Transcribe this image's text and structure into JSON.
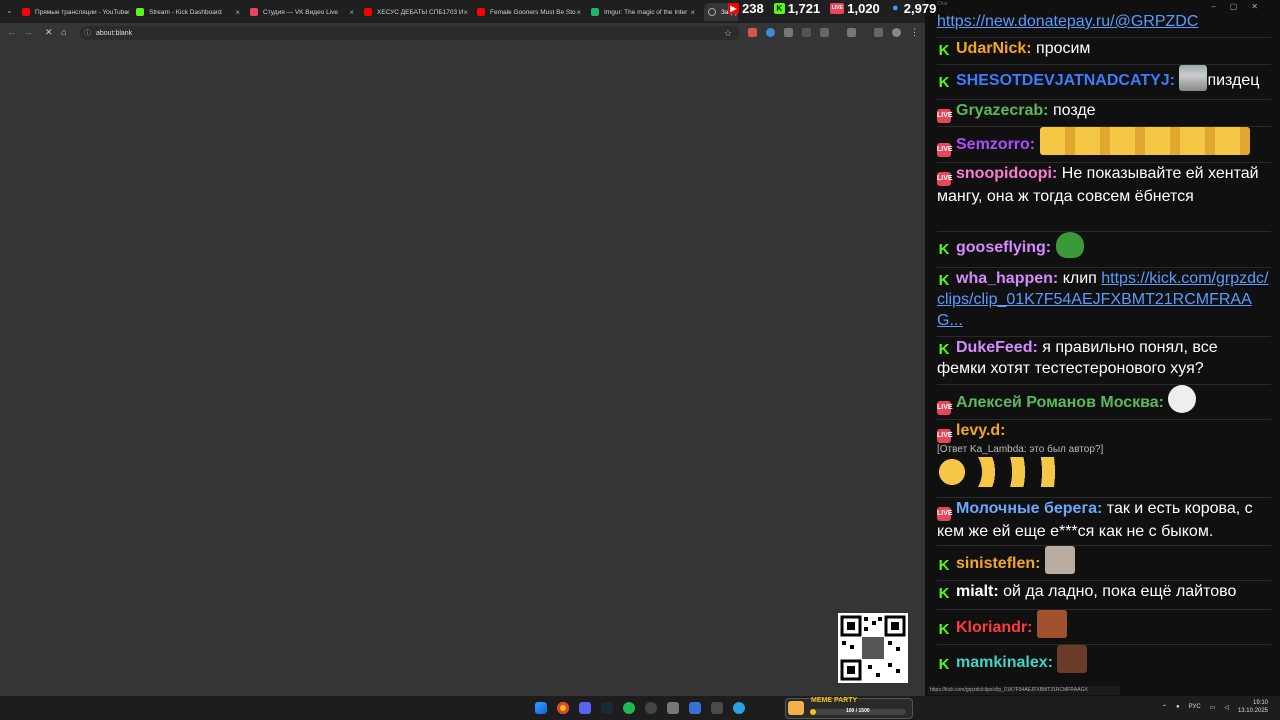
{
  "browser": {
    "tabs": [
      {
        "title": "Прямые трансляции - YouTube",
        "color": "#ff0000"
      },
      {
        "title": "Stream - Kick Dashboard",
        "color": "#53fc18"
      },
      {
        "title": "Студия — VK Видео Live",
        "color": "#e8465a"
      },
      {
        "title": "ХЕСУС ДЕБАТЫ СПБ1703 И",
        "color": "#ff0000"
      },
      {
        "title": "Female Gooners Must Be Sto",
        "color": "#ff0000"
      },
      {
        "title": "Imgur: The magic of the Inter",
        "color": "#1bb76e"
      },
      {
        "title": "Загру",
        "color": "#888888"
      }
    ],
    "address": "about:blank"
  },
  "stats": [
    {
      "platform": "youtube",
      "count": "238",
      "color": "#ff0000",
      "glyph": "▶"
    },
    {
      "platform": "kick",
      "count": "1,721",
      "color": "#53fc18",
      "glyph": "K"
    },
    {
      "platform": "vk",
      "count": "1,020",
      "color": "#e8465a",
      "glyph": "LIVE"
    },
    {
      "platform": "total",
      "count": "2,979",
      "color": "#3aa0ff",
      "glyph": "👤"
    }
  ],
  "chat": {
    "title": "Chat",
    "messages": [
      {
        "badge": "",
        "user": "",
        "user_color": "",
        "text": "",
        "link": "https://new.donatepay.ru/@GRPZDC"
      },
      {
        "badge": "kick",
        "user": "UdarNick:",
        "user_color": "#f5a623",
        "text": "просим"
      },
      {
        "badge": "kick",
        "user": "SHESOTDEVJATNADCATYJ:",
        "user_color": "#3d7bff",
        "text": "пиздец",
        "emote": "trashcan"
      },
      {
        "badge": "live",
        "user": "Gryazecrab:",
        "user_color": "#5cb85c",
        "text": "позде"
      },
      {
        "badge": "live",
        "user": "Semzorro:",
        "user_color": "#b04cff",
        "text": "",
        "emote": "laughs"
      },
      {
        "badge": "live",
        "user": "snoopidoopi:",
        "user_color": "#ff7ad1",
        "text": "Не показывайте ей хентай мангу, она ж тогда совсем ёбнется"
      },
      {
        "badge": "kick",
        "user": "gooseflying:",
        "user_color": "#d68cff",
        "text": "",
        "emote": "pepe"
      },
      {
        "badge": "kick",
        "user": "wha_happen:",
        "user_color": "#d68cff",
        "text": "клип",
        "link": "https://kick.com/grpzdc/clips/clip_01K7F54AEJFXBMT21RCMFRAAG..."
      },
      {
        "badge": "kick",
        "user": "DukeFeed:",
        "user_color": "#d68cff",
        "text": "я правильно понял, все фемки хотят тестестеронового хуя?"
      },
      {
        "badge": "live",
        "user": "Алексей Романов Москва:",
        "user_color": "#5cb85c",
        "text": "",
        "emote": "rage"
      },
      {
        "badge": "live",
        "user": "levy.d:",
        "user_color": "#f5a623",
        "text": "",
        "reply": "[Ответ Ka_Lambda: это был автор?]",
        "emote": "laughs4"
      },
      {
        "badge": "live",
        "user": "Молочные берега:",
        "user_color": "#6aa8ff",
        "text": "так и есть корова, с кем же ей еще е***ся как не с быком."
      },
      {
        "badge": "kick",
        "user": "sinisteflen:",
        "user_color": "#f5a623",
        "text": "",
        "emote": "cat"
      },
      {
        "badge": "kick",
        "user": "mialt:",
        "user_color": "#ffffff",
        "text": "ой да ладно, пока ещё лайтово"
      },
      {
        "badge": "kick",
        "user": "Kloriandr:",
        "user_color": "#ff3b3b",
        "text": "",
        "emote": "face"
      },
      {
        "badge": "kick",
        "user": "mamkinalex:",
        "user_color": "#3dd6c7",
        "text": "",
        "emote": "face2"
      }
    ],
    "status_url": "https://kick.com/grpzdc/clips/clip_01K7F54AEJFXBMT21RCMFRAAGX"
  },
  "meme_party": {
    "title": "MEME PARTY",
    "counter": "100 / 1500",
    "progress": 0.067
  },
  "tray": {
    "lang": "РУС",
    "time": "19:10",
    "date": "13.10.2025"
  }
}
